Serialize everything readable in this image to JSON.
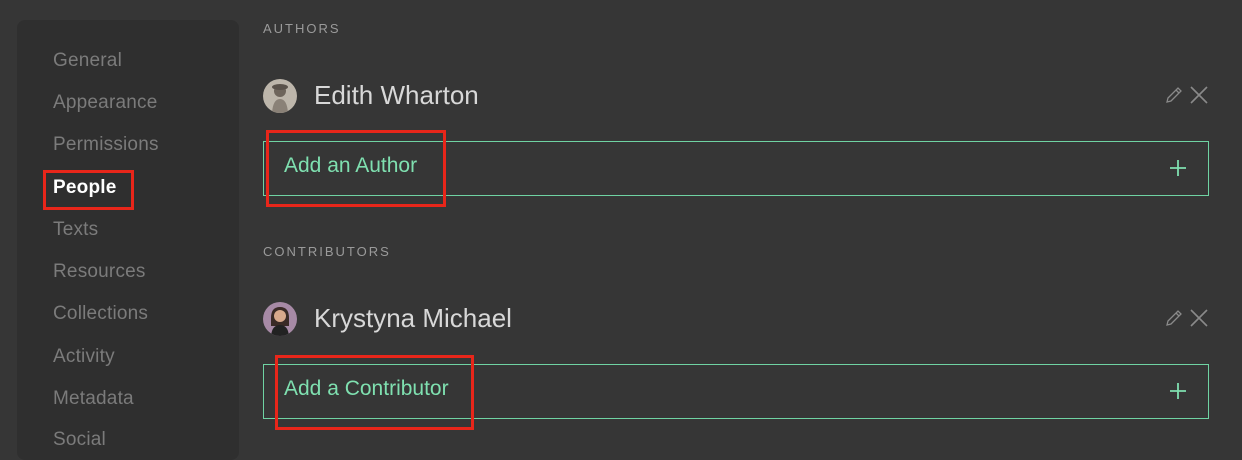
{
  "sidebar": {
    "items": [
      {
        "label": "General",
        "active": false
      },
      {
        "label": "Appearance",
        "active": false
      },
      {
        "label": "Permissions",
        "active": false
      },
      {
        "label": "People",
        "active": true
      },
      {
        "label": "Texts",
        "active": false
      },
      {
        "label": "Resources",
        "active": false
      },
      {
        "label": "Collections",
        "active": false
      },
      {
        "label": "Activity",
        "active": false
      },
      {
        "label": "Metadata",
        "active": false
      },
      {
        "label": "Social",
        "active": false
      }
    ]
  },
  "authors": {
    "section_label": "AUTHORS",
    "people": [
      {
        "name": "Edith Wharton",
        "avatar": "portrait-avatar"
      }
    ],
    "add_label": "Add an Author"
  },
  "contributors": {
    "section_label": "CONTRIBUTORS",
    "people": [
      {
        "name": "Krystyna Michael",
        "avatar": "portrait-avatar"
      }
    ],
    "add_label": "Add a Contributor"
  },
  "icons": {
    "edit": "pencil-icon",
    "remove": "close-icon",
    "add": "plus-icon"
  },
  "colors": {
    "background": "#363636",
    "sidebar": "#2f2f2f",
    "accent": "#7fe0b0",
    "highlight": "#e8261a"
  }
}
